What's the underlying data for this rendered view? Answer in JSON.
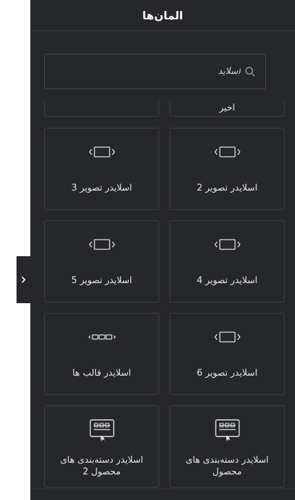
{
  "panel": {
    "title": "المان‌ها"
  },
  "search": {
    "value": "اسلاید",
    "icon": "search-icon"
  },
  "widgets": [
    {
      "label": "",
      "icon": "none"
    },
    {
      "label": "اخیر",
      "icon": "none"
    },
    {
      "label": "اسلایدر تصویر 2",
      "icon": "slider-icon"
    },
    {
      "label": "اسلایدر تصویر 3",
      "icon": "slider-icon"
    },
    {
      "label": "اسلایدر تصویر 4",
      "icon": "slider-icon"
    },
    {
      "label": "اسلایدر تصویر 5",
      "icon": "slider-icon"
    },
    {
      "label": "اسلایدر تصویر 6",
      "icon": "slider-icon"
    },
    {
      "label": "اسلایدر قالب ها",
      "icon": "template-slider-icon"
    },
    {
      "label": "اسلایدر دسته‌بندی های محصول",
      "icon": "product-category-icon"
    },
    {
      "label": "اسلایدر دسته‌بندی های محصول 2",
      "icon": "product-category-icon"
    }
  ],
  "colors": {
    "panel_bg": "#26272b",
    "border": "#404146",
    "text": "#e6e8ea"
  }
}
